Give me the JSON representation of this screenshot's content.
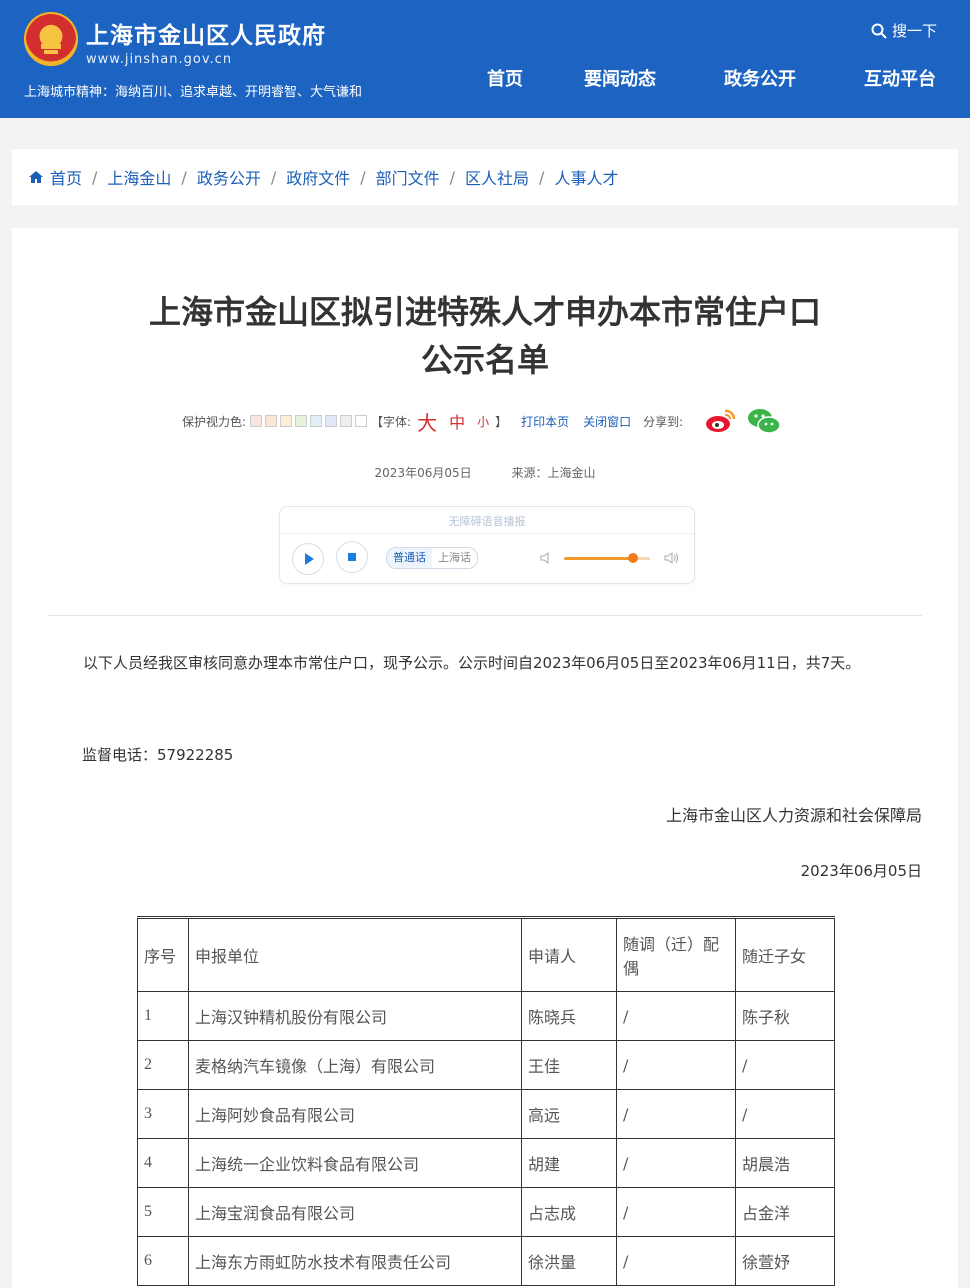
{
  "header": {
    "site_title": "上海市金山区人民政府",
    "site_url": "www.jinshan.gov.cn",
    "slogan": "上海城市精神：海纳百川、追求卓越、开明睿智、大气谦和",
    "search_label": "搜一下",
    "nav": [
      "首页",
      "要闻动态",
      "政务公开",
      "互动平台"
    ]
  },
  "breadcrumb": [
    "首页",
    "上海金山",
    "政务公开",
    "政府文件",
    "部门文件",
    "区人社局",
    "人事人才"
  ],
  "article": {
    "title_line1": "上海市金山区拟引进特殊人才申办本市常住户口",
    "title_line2": "公示名单",
    "toolbar": {
      "color_label": "保护视力色:",
      "font_label": "【字体:",
      "font_big": "大",
      "font_mid": "中",
      "font_small": "小",
      "font_close": "】",
      "print": "打印本页",
      "close": "关闭窗口",
      "share": "分享到:"
    },
    "date": "2023年06月05日",
    "source": "来源：上海金山",
    "player": {
      "title": "无障碍语音播报",
      "lang_options": [
        "普通话",
        "上海话"
      ],
      "volume": 0.8
    },
    "paragraph": "以下人员经我区审核同意办理本市常住户口，现予公示。公示时间自2023年06月05日至2023年06月11日，共7天。",
    "phone": "监督电话：57922285",
    "signer": "上海市金山区人力资源和社会保障局",
    "sign_date": "2023年06月05日"
  },
  "colors": {
    "header_bg": "#1c63c2",
    "link": "#1c5fb8",
    "accent_red": "#d32f2f"
  },
  "swatches": [
    "#f9e3e3",
    "#fbe5d6",
    "#fbefd7",
    "#e6f2dc",
    "#dff1f4",
    "#e3e8f7",
    "#eee",
    "#fff"
  ],
  "table": {
    "headers": [
      "序号",
      "申报单位",
      "申请人",
      "随调（迁）配偶",
      "随迁子女"
    ],
    "rows": [
      [
        "1",
        "上海汉钟精机股份有限公司",
        "陈晓兵",
        "/",
        "陈子秋"
      ],
      [
        "2",
        "麦格纳汽车镜像（上海）有限公司",
        "王佳",
        "/",
        "/"
      ],
      [
        "3",
        "上海阿妙食品有限公司",
        "高远",
        "/",
        "/"
      ],
      [
        "4",
        "上海统一企业饮料食品有限公司",
        "胡建",
        "/",
        "胡晨浩"
      ],
      [
        "5",
        "上海宝润食品有限公司",
        "占志成",
        "/",
        "占金洋"
      ],
      [
        "6",
        "上海东方雨虹防水技术有限责任公司",
        "徐洪量",
        "/",
        "徐萱妤"
      ]
    ]
  }
}
